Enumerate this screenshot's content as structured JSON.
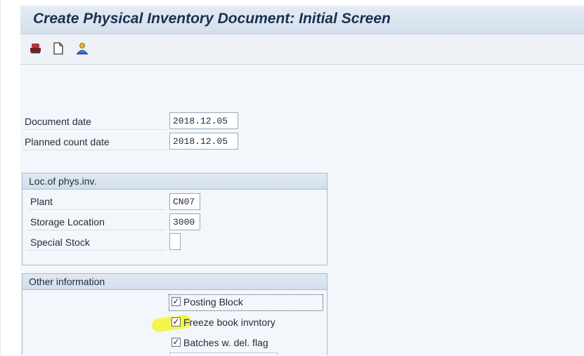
{
  "window": {
    "title": "Create Physical Inventory Document: Initial Screen"
  },
  "toolbar": {
    "icons": [
      "inventory-stamp-icon",
      "new-document-icon",
      "person-settings-icon"
    ]
  },
  "header_fields": {
    "document_date_label": "Document date",
    "document_date_value": "2018.12.05",
    "planned_count_label": "Planned count date",
    "planned_count_value": "2018.12.05"
  },
  "loc_group": {
    "title": "Loc.of phys.inv.",
    "plant_label": "Plant",
    "plant_value": "CN07",
    "storage_label": "Storage Location",
    "storage_value": "3000",
    "special_label": "Special Stock",
    "special_value": ""
  },
  "other_group": {
    "title": "Other information",
    "posting_block": {
      "label": "Posting Block",
      "checked": true
    },
    "freeze_book": {
      "label": "Freeze book invntory",
      "checked": true
    },
    "batches": {
      "label": "Batches w. del. flag",
      "checked": true
    }
  },
  "colors": {
    "highlight": "#f2f52b",
    "title": "#1b3150",
    "group_border": "#a9bbd0"
  }
}
